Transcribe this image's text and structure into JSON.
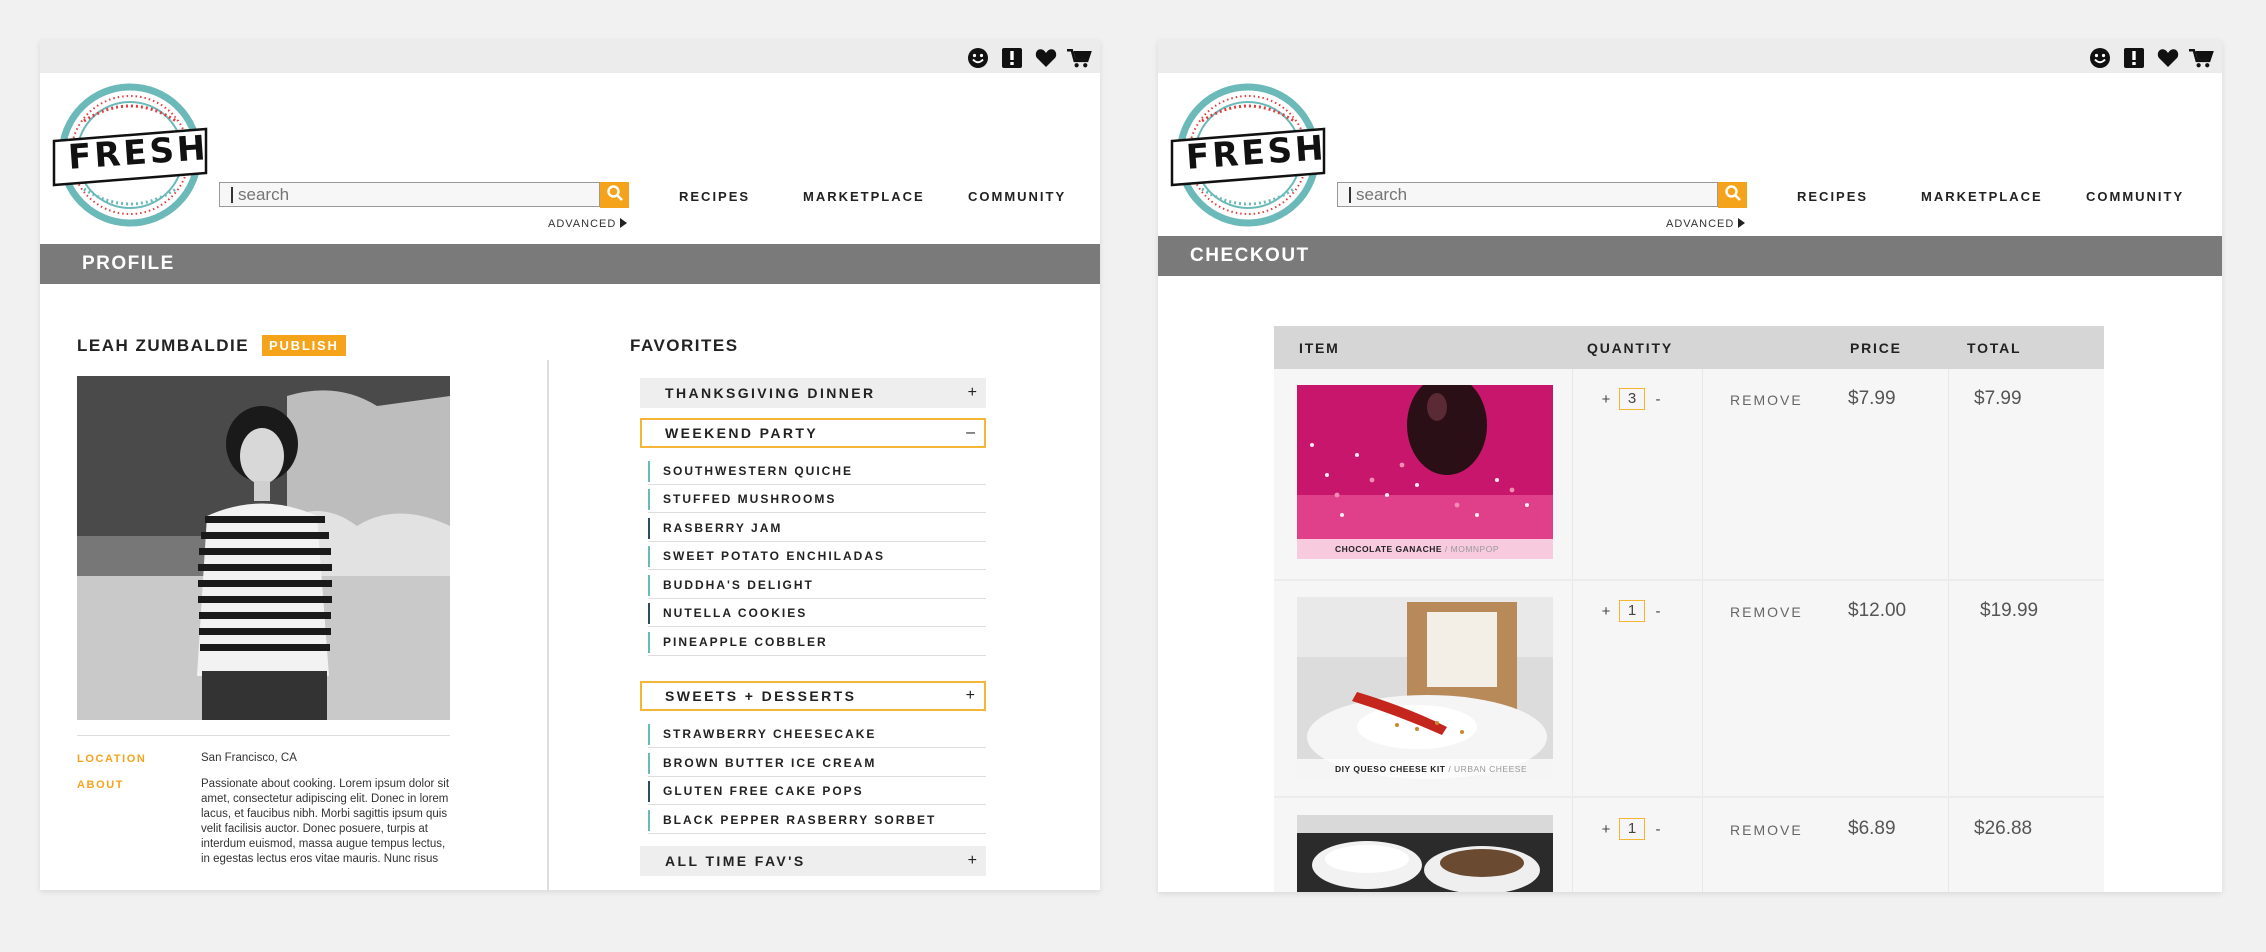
{
  "colors": {
    "accent": "#f5a31a",
    "teal": "#6bb9b8",
    "dark_teal": "#2e4b5e",
    "red": "#e23d3d",
    "section_bar": "#7a7a7a"
  },
  "header": {
    "logo_text": "FRESH",
    "icons": [
      "smiley-icon",
      "alert-icon",
      "heart-icon",
      "cart-icon"
    ],
    "search": {
      "placeholder": "search",
      "button_icon": "search-icon"
    },
    "advanced_label": "ADVANCED",
    "nav": [
      "RECIPES",
      "MARKETPLACE",
      "COMMUNITY"
    ]
  },
  "profile": {
    "section_title": "PROFILE",
    "name": "LEAH ZUMBALDIE",
    "publish_label": "PUBLISH",
    "location_label": "LOCATION",
    "location_value": "San Francisco, CA",
    "about_label": "ABOUT",
    "about_lines": [
      "Passionate about cooking. Lorem ipsum dolor sit",
      "amet, consectetur adipiscing elit. Donec in lorem",
      "lacus, et faucibus nibh. Morbi sagittis ipsum quis",
      "velit facilisis auctor. Donec posuere, turpis at",
      "interdum euismod, massa augue tempus lectus,",
      "in egestas lectus eros vitae mauris. Nunc risus"
    ]
  },
  "favorites": {
    "title": "FAVORITES",
    "sections": [
      {
        "label": "THANKSGIVING DINNER",
        "toggle": "+",
        "items": []
      },
      {
        "label": "WEEKEND PARTY",
        "toggle": "–",
        "items": [
          "SOUTHWESTERN QUICHE",
          "STUFFED MUSHROOMS",
          "RASBERRY JAM",
          "SWEET POTATO ENCHILADAS",
          "BUDDHA'S DELIGHT",
          "NUTELLA COOKIES",
          "PINEAPPLE COBBLER"
        ]
      },
      {
        "label": "SWEETS + DESSERTS",
        "toggle": "+",
        "items": [
          "STRAWBERRY CHEESECAKE",
          "BROWN BUTTER ICE CREAM",
          "GLUTEN FREE CAKE POPS",
          "BLACK PEPPER RASBERRY SORBET"
        ]
      },
      {
        "label": "ALL TIME FAV'S",
        "toggle": "+",
        "items": []
      }
    ]
  },
  "checkout": {
    "section_title": "CHECKOUT",
    "columns": [
      "ITEM",
      "QUANTITY",
      "PRICE",
      "TOTAL"
    ],
    "remove_label": "REMOVE",
    "rows": [
      {
        "caption": "CHOCOLATE GANACHE",
        "caption_sub": " / MOMNPOP",
        "qty": "3",
        "price": "$7.99",
        "total": "$7.99"
      },
      {
        "caption": "DIY QUESO CHEESE KIT",
        "caption_sub": " / URBAN CHEESE",
        "qty": "1",
        "price": "$12.00",
        "total": "$19.99"
      },
      {
        "caption": "",
        "caption_sub": "",
        "qty": "1",
        "price": "$6.89",
        "total": "$26.88"
      }
    ]
  }
}
